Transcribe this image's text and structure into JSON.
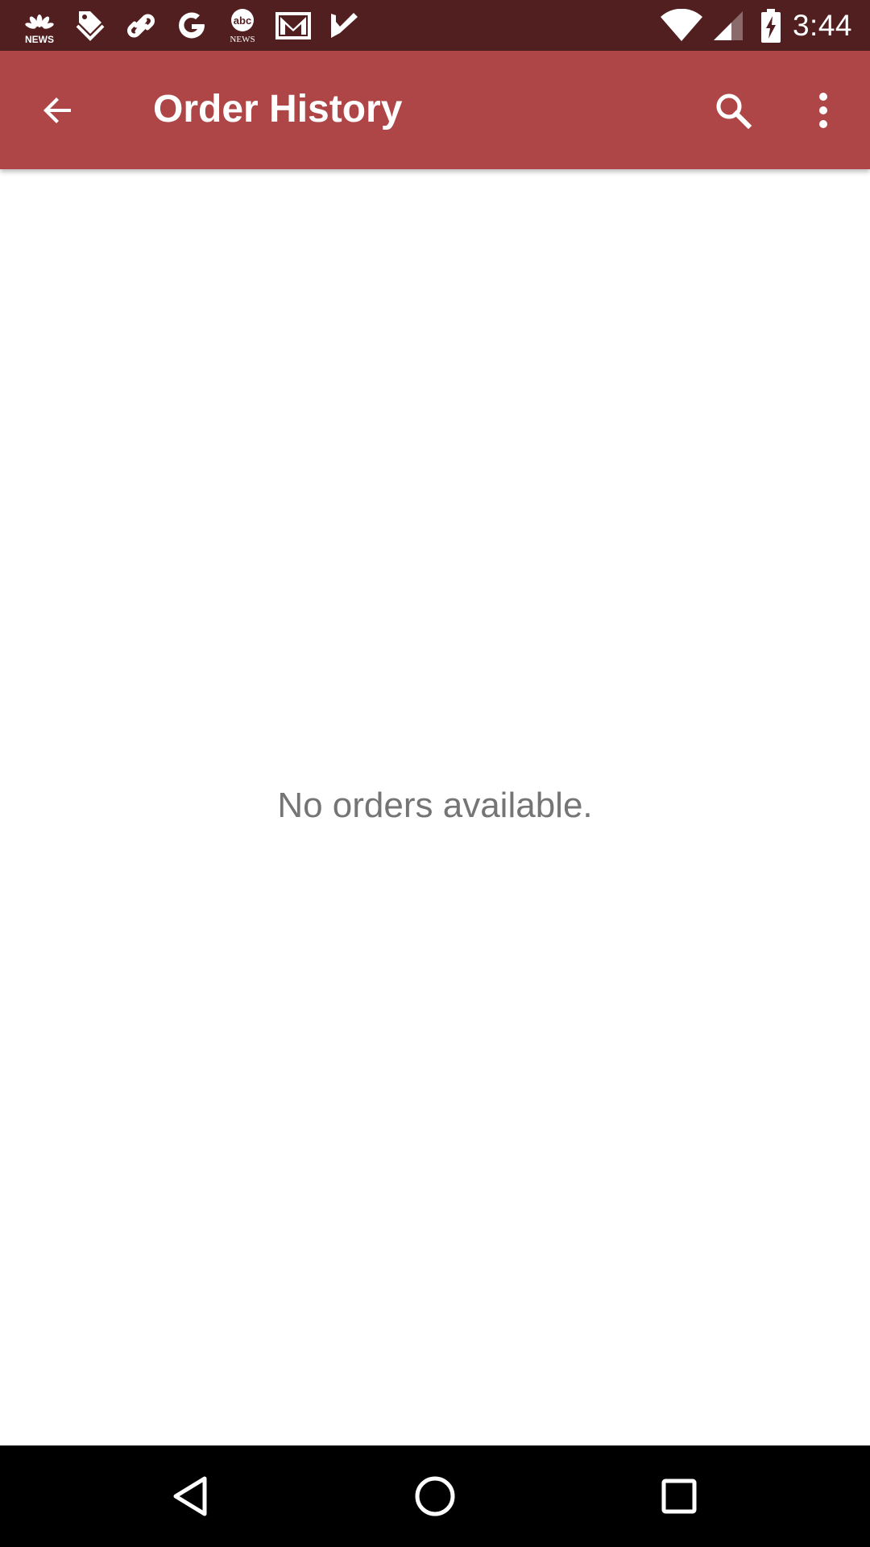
{
  "status_bar": {
    "time": "3:44",
    "notification_icons": [
      "nbc-news-icon",
      "tag-icon",
      "link-icon",
      "google-icon",
      "abc-news-icon",
      "gmail-icon",
      "checkmark-icon"
    ],
    "nbc_label": "NEWS",
    "abc_label": "abc",
    "abc_sub_label": "NEWS",
    "system_icons": [
      "wifi-icon",
      "signal-icon",
      "battery-charging-icon"
    ]
  },
  "app_bar": {
    "title": "Order History",
    "back_icon": "arrow-left-icon",
    "search_icon": "search-icon",
    "overflow_icon": "more-vert-icon"
  },
  "content": {
    "empty_message": "No orders available."
  },
  "nav_bar": {
    "buttons": [
      "back-triangle-icon",
      "home-circle-icon",
      "recents-square-icon"
    ]
  },
  "colors": {
    "status_bar": "#511f20",
    "app_bar": "#ae4546",
    "empty_text": "#757575",
    "nav_bar": "#000000"
  }
}
